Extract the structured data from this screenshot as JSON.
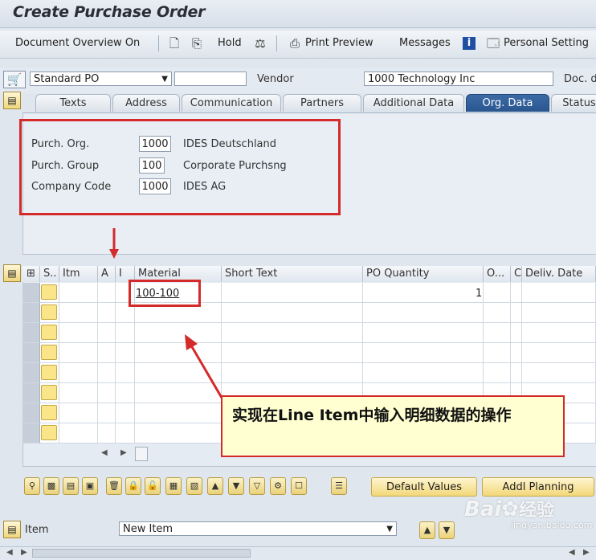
{
  "window": {
    "title": "Create Purchase Order"
  },
  "toolbar": {
    "document_overview": "Document Overview On",
    "hold": "Hold",
    "print_preview": "Print Preview",
    "messages": "Messages",
    "personal_setting": "Personal Setting"
  },
  "header": {
    "po_type": "Standard PO",
    "po_number": "",
    "vendor_label": "Vendor",
    "vendor_value": "1000 Technology Inc",
    "doc_date_label": "Doc. d"
  },
  "tabs": [
    "Texts",
    "Address",
    "Communication",
    "Partners",
    "Additional Data",
    "Org. Data",
    "Status"
  ],
  "active_tab": "Org. Data",
  "org_data": {
    "purch_org_label": "Purch. Org.",
    "purch_org_value": "1000",
    "purch_org_desc": "IDES Deutschland",
    "purch_group_label": "Purch. Group",
    "purch_group_value": "100",
    "purch_group_desc": "Corporate Purchsng",
    "company_code_label": "Company Code",
    "company_code_value": "1000",
    "company_code_desc": "IDES AG"
  },
  "items_table": {
    "columns": [
      "S..",
      "Itm",
      "A",
      "I",
      "Material",
      "Short Text",
      "PO Quantity",
      "O...",
      "C",
      "Deliv. Date"
    ],
    "rows": [
      {
        "material": "100-100",
        "po_quantity": "1"
      }
    ]
  },
  "buttons": {
    "default_values": "Default Values",
    "addl_planning": "Addl Planning"
  },
  "item_bar": {
    "label": "Item",
    "selected": "New Item"
  },
  "callout": {
    "text": "实现在Line Item中输入明细数据的操作"
  },
  "watermark": {
    "brand": "Bai",
    "brand_mark": "经验",
    "url": "jingyan.baidu.com"
  },
  "colors": {
    "accent_red": "#d42a2a",
    "tab_active": "#2a568f",
    "yellow_cell": "#fbe58b"
  }
}
